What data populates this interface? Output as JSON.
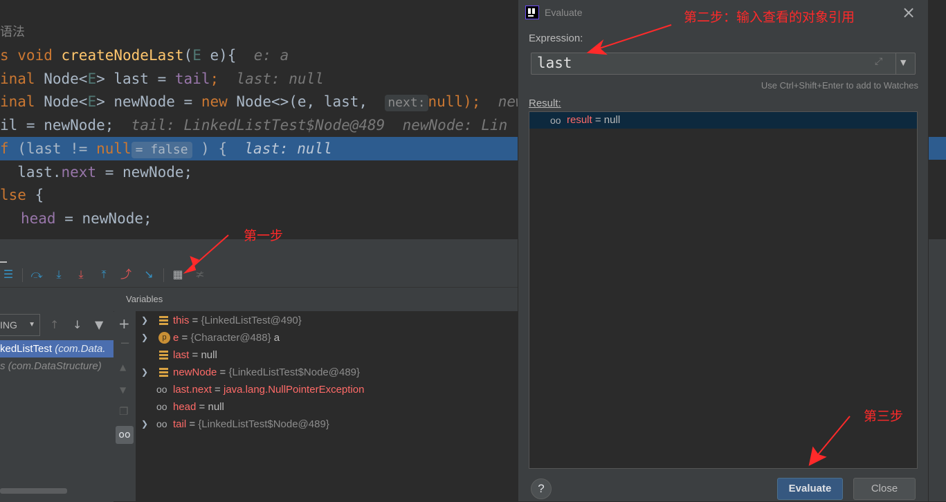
{
  "editor": {
    "lines": {
      "l1": "语法",
      "l2_kw": "s void ",
      "l2_fn": "createNodeLast",
      "l2_rest": "(",
      "l2_E": "E",
      "l2_tail": " e){",
      "l2_inline": "e: a",
      "l3_kw": "inal ",
      "l3_type": "Node<",
      "l3_E": "E",
      "l3_rest": "> last = ",
      "l3_fld": "tail",
      "l3_semi": ";",
      "l3_inline": "last: null",
      "l4_kw": "inal ",
      "l4_type": "Node<",
      "l4_E": "E",
      "l4_rest": "> newNode = ",
      "l4_new": "new ",
      "l4_rest2": "Node<>(e, last, ",
      "l4_hint": "next:",
      "l4_null": "null",
      "l4_end": ");",
      "l4_inline": "new",
      "l5_a": "il = newNode;",
      "l5_inline": "tail: LinkedListTest$Node@489  newNode: Lin",
      "l6_kw": "f",
      "l6_a": " (last != ",
      "l6_null": "null",
      "l6_hint": "= false",
      "l6_b": " ) {",
      "l6_inline": "last: null",
      "l7_a": "  last.",
      "l7_fld": "next",
      "l7_b": " = newNode;",
      "l8_kw": "lse",
      "l8_b": " {",
      "l9_fld": "head",
      "l9_b": " = newNode;"
    }
  },
  "annotations": {
    "step1": "第一步",
    "step2": "第二步：输入查看的对象引用",
    "step3": "第三步"
  },
  "debug": {
    "variables_title": "Variables",
    "thread_select": "ING",
    "frames": [
      {
        "name": "kedListTest",
        "pkg": " (com.Data."
      },
      {
        "name": "",
        "pkg": "(com.DataStructure)"
      }
    ],
    "variables": [
      {
        "name": "this",
        "eq": " = ",
        "val": "{LinkedListTest@490}"
      },
      {
        "name": "e",
        "eq": " = ",
        "val": "{Character@488}",
        "extra": " a"
      },
      {
        "name": "last",
        "eq": " = ",
        "val": "null"
      },
      {
        "name": "newNode",
        "eq": " = ",
        "val": "{LinkedListTest$Node@489}"
      },
      {
        "name": "last.next",
        "eq": " = ",
        "val": "java.lang.NullPointerException"
      },
      {
        "name": "head",
        "eq": " = ",
        "val": "null"
      },
      {
        "name": "tail",
        "eq": " = ",
        "val": "{LinkedListTest$Node@489}"
      }
    ],
    "e_badge": "p"
  },
  "dialog": {
    "title": "Evaluate",
    "expression_label": "Expression:",
    "expression_value": "last",
    "hint": "Use Ctrl+Shift+Enter to add to Watches",
    "result_label": "Result:",
    "result_name": "result",
    "result_eq": " = ",
    "result_val": "null",
    "help": "?",
    "evaluate_button": "Evaluate",
    "close_button": "Close",
    "close_icon": "×"
  },
  "colors": {
    "selection": "#2d5c8f",
    "annotation": "#ff2a2a",
    "primary_button": "#365880"
  }
}
